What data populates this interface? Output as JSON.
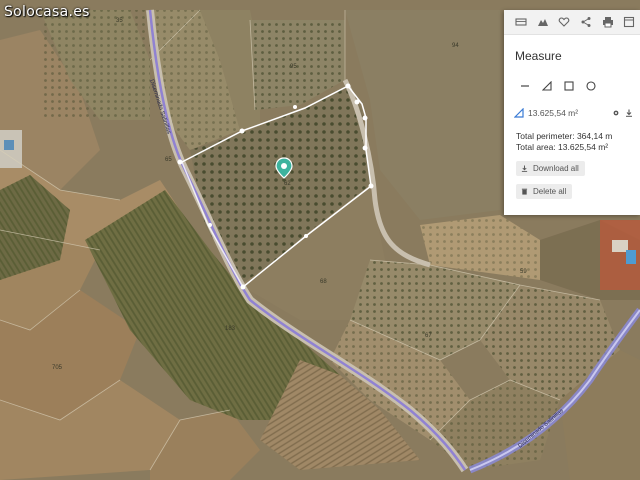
{
  "watermark": "Solocasa.es",
  "toolbar": {
    "icons": [
      "layers-icon",
      "terrain-icon",
      "heart-icon",
      "share-icon",
      "print-icon",
      "window-icon"
    ]
  },
  "panel": {
    "title": "Measure",
    "result_area": "13.625,54 m²",
    "total_perimeter": "Total perimeter: 364,14 m",
    "total_area": "Total area: 13.625,54 m²",
    "download_all": "Download all",
    "delete_all": "Delete all"
  },
  "map_labels": {
    "parcel_35": "35",
    "parcel_94": "94",
    "parcel_95": "95",
    "parcel_65": "65",
    "parcel_62": "62",
    "parcel_67": "67",
    "parcel_68": "68",
    "parcel_705": "705",
    "parcel_183": "183",
    "parcel_59": "59",
    "road_left": "Diseminado Salinillas",
    "road_bottom": "Diseminado Salinillas"
  },
  "colors": {
    "measure_line": "#ffffff",
    "road_overlay": "#8a7bd6",
    "pin": "#3db39e",
    "panel_accent": "#3a7bd5"
  }
}
